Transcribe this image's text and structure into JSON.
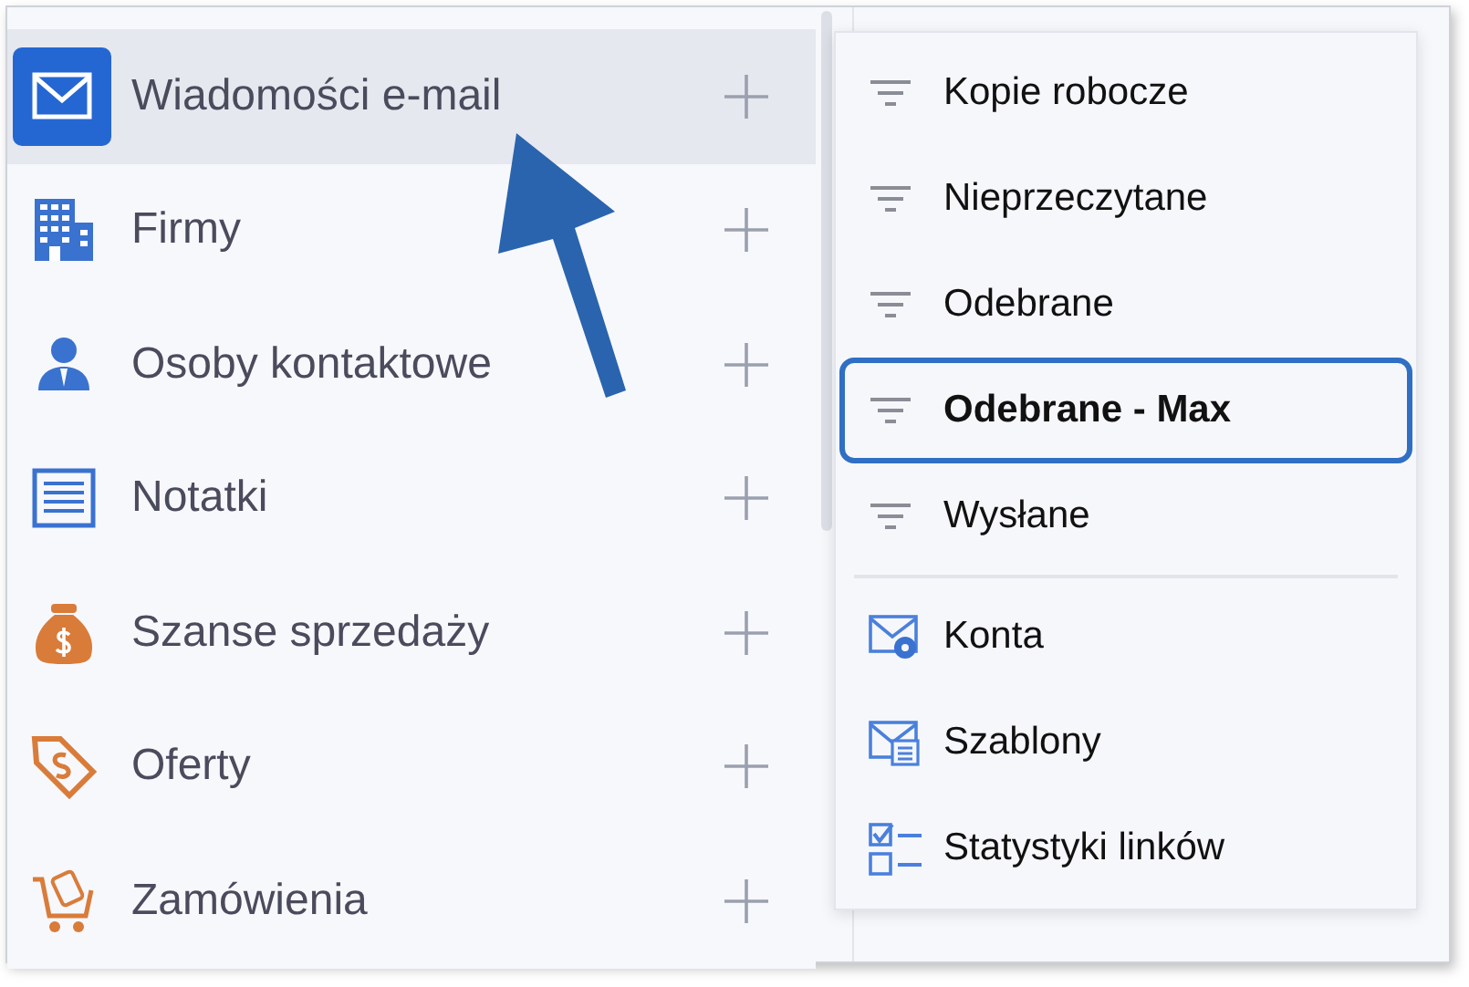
{
  "sidebar": {
    "items": [
      {
        "kind": "mail",
        "label": "Wiadomości e-mail",
        "selected": true
      },
      {
        "kind": "building",
        "label": "Firmy",
        "selected": false
      },
      {
        "kind": "person",
        "label": "Osoby kontaktowe",
        "selected": false
      },
      {
        "kind": "note",
        "label": "Notatki",
        "selected": false
      },
      {
        "kind": "moneybag",
        "label": "Szanse sprzedaży",
        "selected": false
      },
      {
        "kind": "tag",
        "label": "Oferty",
        "selected": false
      },
      {
        "kind": "cart",
        "label": "Zamówienia",
        "selected": false
      }
    ]
  },
  "submenu": {
    "groups": [
      {
        "items": [
          {
            "kind": "filter",
            "label": "Kopie robocze",
            "selected": false
          },
          {
            "kind": "filter",
            "label": "Nieprzeczytane",
            "selected": false
          },
          {
            "kind": "filter",
            "label": "Odebrane",
            "selected": false
          },
          {
            "kind": "filter",
            "label": "Odebrane - Max",
            "selected": true
          },
          {
            "kind": "filter",
            "label": "Wysłane",
            "selected": false
          }
        ]
      },
      {
        "items": [
          {
            "kind": "accounts",
            "label": "Konta",
            "selected": false
          },
          {
            "kind": "templates",
            "label": "Szablony",
            "selected": false
          },
          {
            "kind": "stats",
            "label": "Statystyki linków",
            "selected": false
          }
        ]
      }
    ]
  }
}
